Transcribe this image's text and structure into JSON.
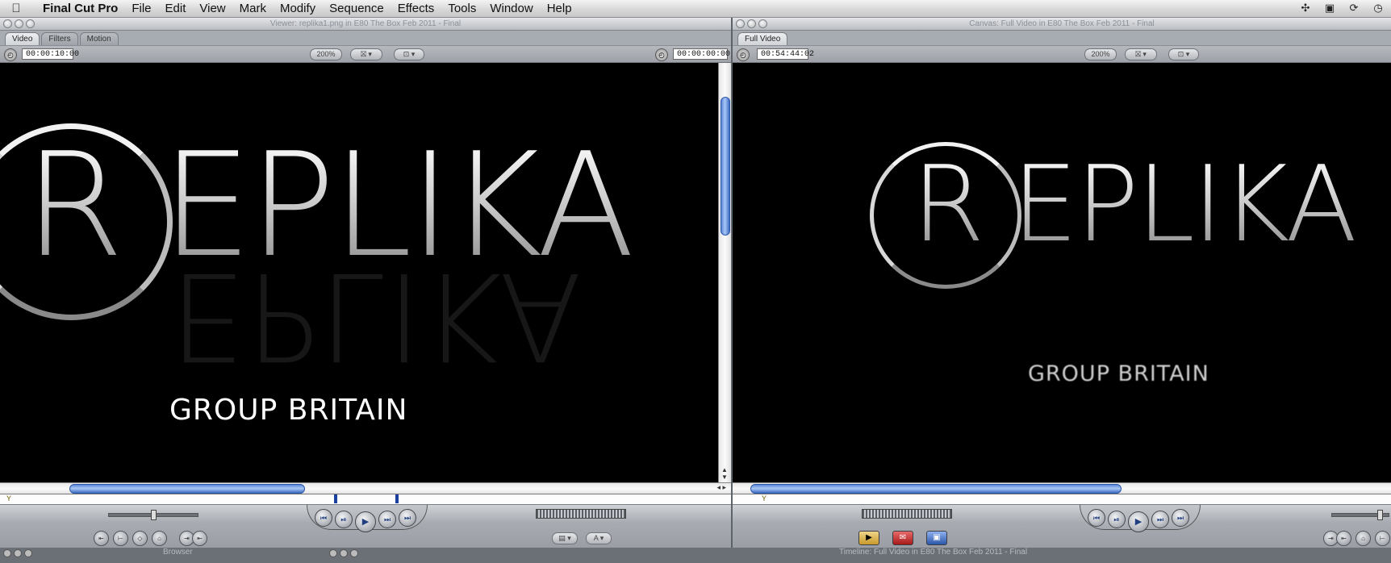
{
  "menubar": {
    "apple": "",
    "app_name": "Final Cut Pro",
    "items": [
      "File",
      "Edit",
      "View",
      "Mark",
      "Modify",
      "Sequence",
      "Effects",
      "Tools",
      "Window",
      "Help"
    ]
  },
  "viewer": {
    "title": "Viewer: replika1.png in E80 The Box Feb 2011 - Final",
    "tabs": [
      "Video",
      "Filters",
      "Motion"
    ],
    "duration": "00:00:10:00",
    "zoom": "200%",
    "current_tc": "00:00:00:00",
    "logo_main": "EPLIKA",
    "logo_letter": "R",
    "logo_sub": "GROUP BRITAIN"
  },
  "canvas": {
    "title": "Canvas: Full Video in E80 The Box Feb 2011 - Final",
    "tabs": [
      "Full Video"
    ],
    "timecode": "00:54:44:02",
    "zoom": "200%",
    "logo_main": "EPLIKA",
    "logo_letter": "R",
    "logo_sub": "GROUP BRITAIN"
  },
  "bottom": {
    "browser_title": "Browser",
    "timeline_title": "Timeline: Full Video in E80 The Box Feb 2011 - Final"
  },
  "icons": {
    "play": "▶",
    "step_back": "⏮",
    "step_fwd": "⏭",
    "prev": "◀",
    "next": "▶"
  },
  "colors": {
    "scroll_accent": "#5a86d8",
    "menu_bar": "#e6e6e6",
    "panel": "#a7abb2"
  }
}
